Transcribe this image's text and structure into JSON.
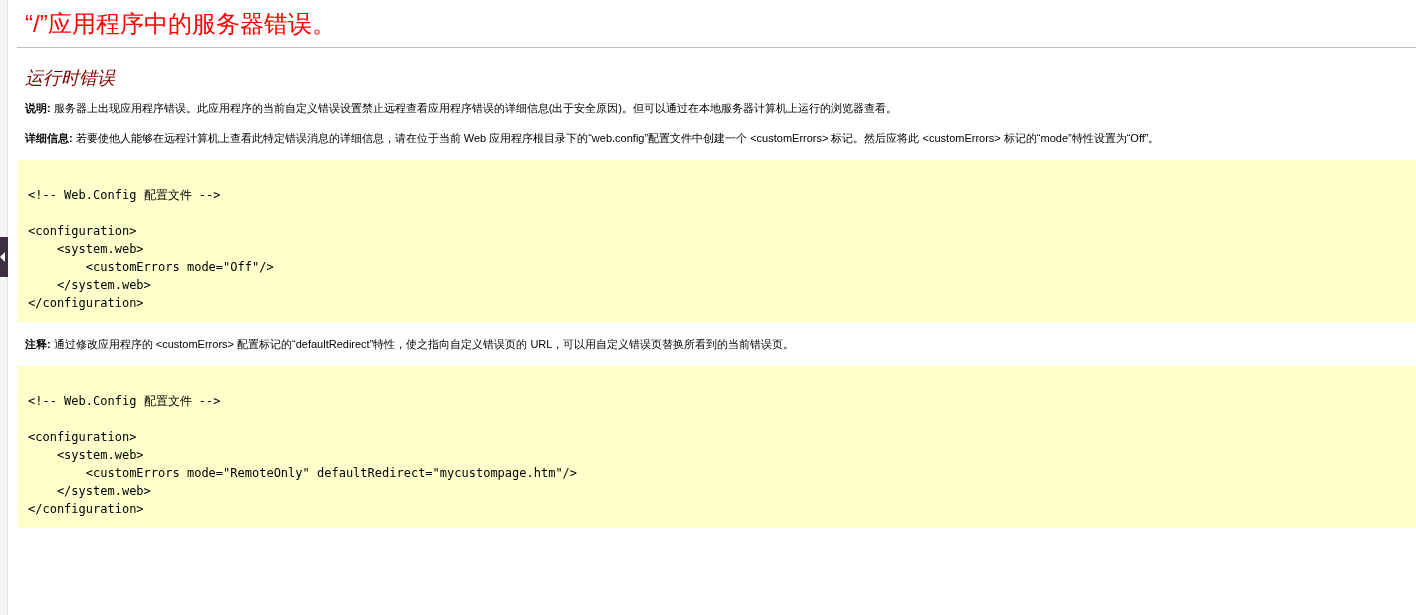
{
  "title": "“/”应用程序中的服务器错误。",
  "subtitle": "运行时错误",
  "sections": [
    {
      "kind": "paragraph",
      "label": "说明:",
      "text": "服务器上出现应用程序错误。此应用程序的当前自定义错误设置禁止远程查看应用程序错误的详细信息(出于安全原因)。但可以通过在本地服务器计算机上运行的浏览器查看。"
    },
    {
      "kind": "paragraph",
      "label": "详细信息:",
      "text": "若要使他人能够在远程计算机上查看此特定错误消息的详细信息，请在位于当前 Web 应用程序根目录下的“web.config”配置文件中创建一个 <customErrors> 标记。然后应将此 <customErrors> 标记的“mode”特性设置为“Off”。"
    },
    {
      "kind": "code",
      "text": "<!-- Web.Config 配置文件 -->\n\n<configuration>\n    <system.web>\n        <customErrors mode=\"Off\"/>\n    </system.web>\n</configuration>"
    },
    {
      "kind": "paragraph",
      "label": "注释:",
      "text": "通过修改应用程序的 <customErrors> 配置标记的“defaultRedirect”特性，使之指向自定义错误页的 URL，可以用自定义错误页替换所看到的当前错误页。"
    },
    {
      "kind": "code",
      "text": "<!-- Web.Config 配置文件 -->\n\n<configuration>\n    <system.web>\n        <customErrors mode=\"RemoteOnly\" defaultRedirect=\"mycustompage.htm\"/>\n    </system.web>\n</configuration>"
    }
  ]
}
